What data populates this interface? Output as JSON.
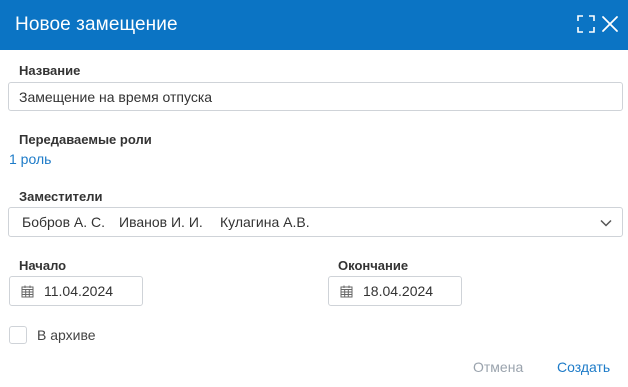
{
  "dialog": {
    "title": "Новое замещение",
    "accent_color": "#0b74c4",
    "link_color": "#1d7bc8"
  },
  "form": {
    "name": {
      "label": "Название",
      "value": "Замещение на время отпуска"
    },
    "roles": {
      "label": "Передаваемые роли",
      "link": "1 роль"
    },
    "deputies": {
      "label": "Заместители",
      "selected": [
        "Бобров А. С.",
        "Иванов И. И.",
        "Кулагина А.В."
      ],
      "icon": "chevron-down-icon"
    },
    "start": {
      "label": "Начало",
      "value": "11.04.2024",
      "icon": "calendar-icon"
    },
    "end": {
      "label": "Окончание",
      "value": "18.04.2024",
      "icon": "calendar-icon"
    },
    "archive": {
      "label": "В архиве",
      "checked": false
    }
  },
  "footer": {
    "cancel_label": "Отмена",
    "create_label": "Создать"
  }
}
